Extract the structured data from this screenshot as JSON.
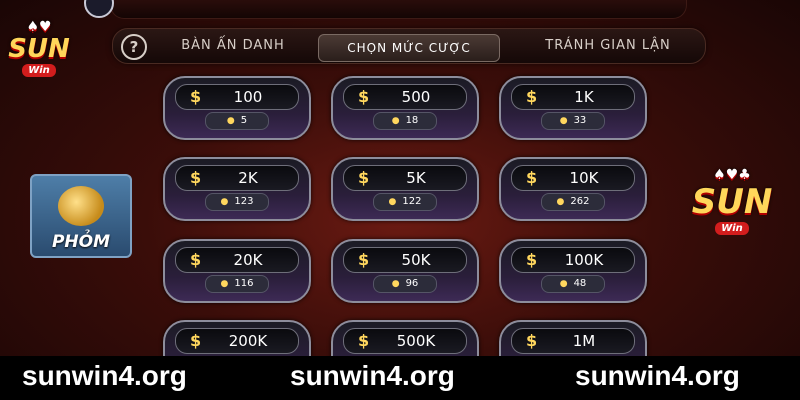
{
  "tabs": [
    {
      "label": "BÀN ẤN DANH"
    },
    {
      "label": "CHỌN MỨC CƯỢC"
    },
    {
      "label": "TRÁNH GIAN LẬN"
    }
  ],
  "help_icon": "?",
  "currency_symbol": "$",
  "player_icon": "person-icon",
  "bets": [
    {
      "amount": "100",
      "players": "5"
    },
    {
      "amount": "500",
      "players": "18"
    },
    {
      "amount": "1K",
      "players": "33"
    },
    {
      "amount": "2K",
      "players": "123"
    },
    {
      "amount": "5K",
      "players": "122"
    },
    {
      "amount": "10K",
      "players": "262"
    },
    {
      "amount": "20K",
      "players": "116"
    },
    {
      "amount": "50K",
      "players": "96"
    },
    {
      "amount": "100K",
      "players": "48"
    },
    {
      "amount": "200K",
      "players": ""
    },
    {
      "amount": "500K",
      "players": ""
    },
    {
      "amount": "1M",
      "players": ""
    }
  ],
  "logo": {
    "text": "SUN",
    "sub": "Win"
  },
  "game_tile": {
    "title": "PHỎM"
  },
  "footer": [
    "sunwin4.org",
    "sunwin4.org",
    "sunwin4.org"
  ],
  "colors": {
    "accent": "#ffd75e",
    "card_border": "#8d8d9c",
    "card_bottom": "#3d2a55"
  }
}
